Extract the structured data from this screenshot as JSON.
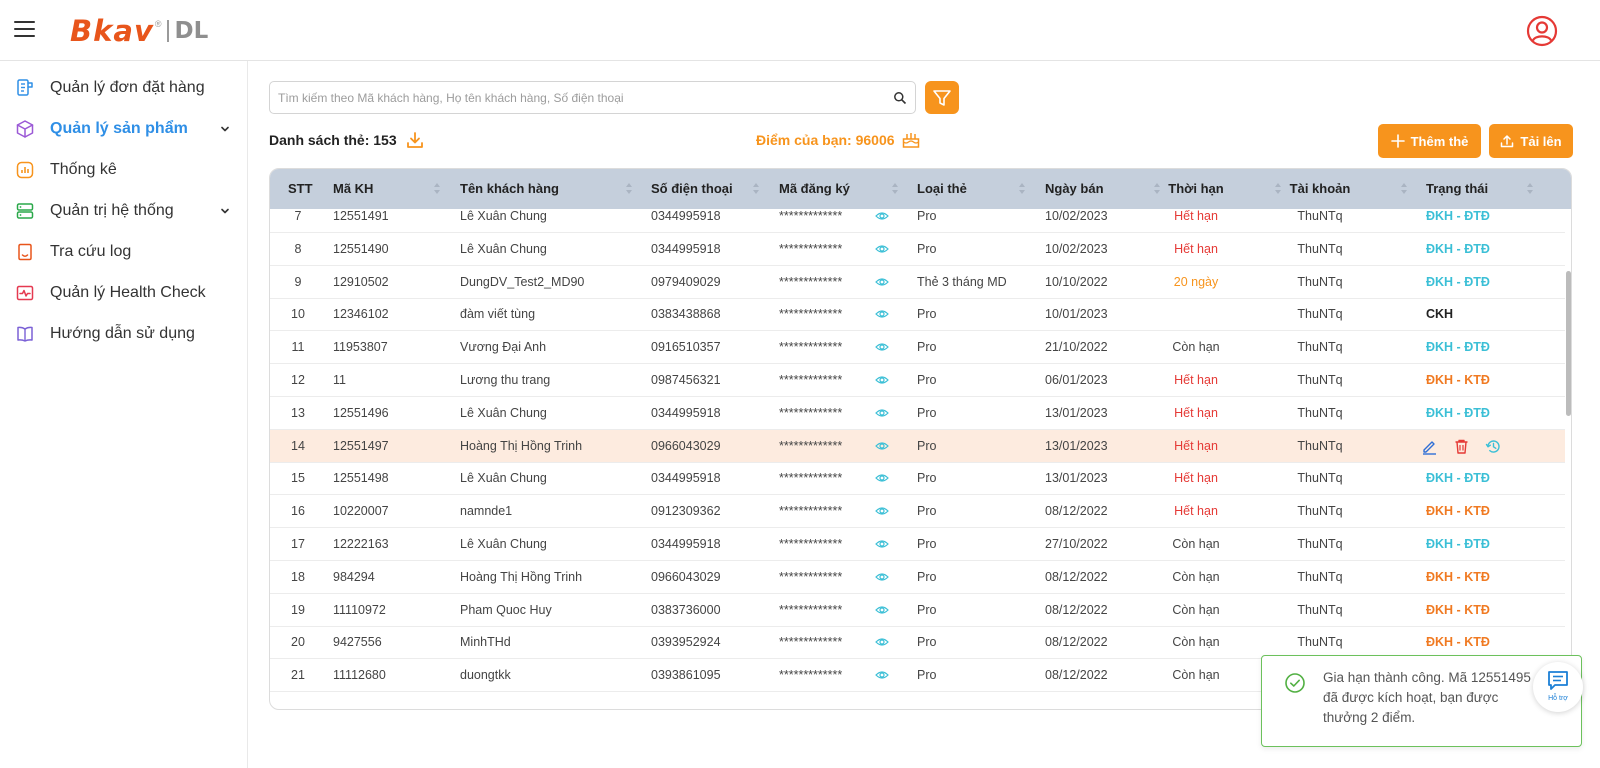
{
  "header": {
    "logo_main": "Bkav",
    "logo_dot": "®",
    "logo_sub": "DL"
  },
  "sidebar": {
    "items": [
      {
        "label": "Quản lý đơn đặt hàng",
        "icon": "order-icon",
        "active": false,
        "expandable": false
      },
      {
        "label": "Quản lý sản phẩm",
        "icon": "product-box-icon",
        "active": true,
        "expandable": true
      },
      {
        "label": "Thống kê",
        "icon": "stats-icon",
        "active": false,
        "expandable": false
      },
      {
        "label": "Quản trị hệ thống",
        "icon": "server-icon",
        "active": false,
        "expandable": true
      },
      {
        "label": "Tra cứu log",
        "icon": "log-icon",
        "active": false,
        "expandable": false
      },
      {
        "label": "Quản lý Health Check",
        "icon": "health-check-icon",
        "active": false,
        "expandable": false
      },
      {
        "label": "Hướng dẫn sử dụng",
        "icon": "guide-book-icon",
        "active": false,
        "expandable": false
      }
    ]
  },
  "search": {
    "placeholder": "Tìm kiếm theo Mã khách hàng, Họ tên khách hàng, Số điện thoại",
    "value": ""
  },
  "list": {
    "title": "Danh sách thẻ: 153",
    "points": "Điểm của bạn: 96006"
  },
  "actions": {
    "add_label": "Thêm thẻ",
    "upload_label": "Tải lên"
  },
  "table": {
    "columns": [
      "STT",
      "Mã KH",
      "Tên khách hàng",
      "Số điện thoại",
      "Mã đăng ký",
      "Loại thẻ",
      "Ngày bán",
      "Thời hạn",
      "Tài khoản",
      "Trạng thái"
    ],
    "rows": [
      {
        "stt": "7",
        "makh": "12551491",
        "name": "Lê Xuân Chung",
        "phone": "0344995918",
        "code": "*************",
        "type": "Pro",
        "date": "10/02/2023",
        "term": "Hết hạn",
        "account": "ThuNTq",
        "status": "ĐKH - ĐTĐ"
      },
      {
        "stt": "8",
        "makh": "12551490",
        "name": "Lê Xuân Chung",
        "phone": "0344995918",
        "code": "*************",
        "type": "Pro",
        "date": "10/02/2023",
        "term": "Hết hạn",
        "account": "ThuNTq",
        "status": "ĐKH - ĐTĐ"
      },
      {
        "stt": "9",
        "makh": "12910502",
        "name": "DungDV_Test2_MD90",
        "phone": "0979409029",
        "code": "*************",
        "type": "Thẻ 3 tháng MD",
        "date": "10/10/2022",
        "term": "20 ngày",
        "account": "ThuNTq",
        "status": "ĐKH - ĐTĐ"
      },
      {
        "stt": "10",
        "makh": "12346102",
        "name": "đàm viết tùng",
        "phone": "0383438868",
        "code": "*************",
        "type": "Pro",
        "date": "10/01/2023",
        "term": "",
        "account": "ThuNTq",
        "status": "CKH"
      },
      {
        "stt": "11",
        "makh": "11953807",
        "name": "Vương Đại Anh",
        "phone": "0916510357",
        "code": "*************",
        "type": "Pro",
        "date": "21/10/2022",
        "term": "Còn hạn",
        "account": "ThuNTq",
        "status": "ĐKH - ĐTĐ"
      },
      {
        "stt": "12",
        "makh": "11",
        "name": "Lương thu trang",
        "phone": "0987456321",
        "code": "*************",
        "type": "Pro",
        "date": "06/01/2023",
        "term": "Hết hạn",
        "account": "ThuNTq",
        "status": "ĐKH - KTĐ"
      },
      {
        "stt": "13",
        "makh": "12551496",
        "name": "Lê Xuân Chung",
        "phone": "0344995918",
        "code": "*************",
        "type": "Pro",
        "date": "13/01/2023",
        "term": "Hết hạn",
        "account": "ThuNTq",
        "status": "ĐKH - ĐTĐ"
      },
      {
        "stt": "14",
        "makh": "12551497",
        "name": "Hoàng Thị Hồng Trinh",
        "phone": "0966043029",
        "code": "*************",
        "type": "Pro",
        "date": "13/01/2023",
        "term": "Hết hạn",
        "account": "ThuNTq",
        "status": ""
      },
      {
        "stt": "15",
        "makh": "12551498",
        "name": "Lê Xuân Chung",
        "phone": "0344995918",
        "code": "*************",
        "type": "Pro",
        "date": "13/01/2023",
        "term": "Hết hạn",
        "account": "ThuNTq",
        "status": "ĐKH - ĐTĐ"
      },
      {
        "stt": "16",
        "makh": "10220007",
        "name": "namnde1",
        "phone": "0912309362",
        "code": "*************",
        "type": "Pro",
        "date": "08/12/2022",
        "term": "Hết hạn",
        "account": "ThuNTq",
        "status": "ĐKH - KTĐ"
      },
      {
        "stt": "17",
        "makh": "12222163",
        "name": "Lê Xuân Chung",
        "phone": "0344995918",
        "code": "*************",
        "type": "Pro",
        "date": "27/10/2022",
        "term": "Còn hạn",
        "account": "ThuNTq",
        "status": "ĐKH - ĐTĐ"
      },
      {
        "stt": "18",
        "makh": "984294",
        "name": "Hoàng Thị Hồng Trinh",
        "phone": "0966043029",
        "code": "*************",
        "type": "Pro",
        "date": "08/12/2022",
        "term": "Còn hạn",
        "account": "ThuNTq",
        "status": "ĐKH - KTĐ"
      },
      {
        "stt": "19",
        "makh": "11110972",
        "name": "Pham Quoc Huy",
        "phone": "0383736000",
        "code": "*************",
        "type": "Pro",
        "date": "08/12/2022",
        "term": "Còn hạn",
        "account": "ThuNTq",
        "status": "ĐKH - KTĐ"
      },
      {
        "stt": "20",
        "makh": "9427556",
        "name": "MinhTHd",
        "phone": "0393952924",
        "code": "*************",
        "type": "Pro",
        "date": "08/12/2022",
        "term": "Còn hạn",
        "account": "ThuNTq",
        "status": "ĐKH - KTĐ"
      },
      {
        "stt": "21",
        "makh": "11112680",
        "name": "duongtkk",
        "phone": "0393861095",
        "code": "*************",
        "type": "Pro",
        "date": "08/12/2022",
        "term": "Còn hạn",
        "account": "ThuNTq",
        "status": ""
      }
    ]
  },
  "toast": {
    "message": "Gia hạn thành công. Mã 12551495 đã được kích hoạt, bạn được thưởng 2 điểm."
  },
  "support": {
    "label": "Hỗ trợ"
  },
  "colors": {
    "accent": "#f7941d",
    "brand": "#e8551b",
    "active_nav": "#2f8fe6",
    "expired": "#e53935",
    "warning": "#f7941d",
    "status_teal": "#3bbfd6",
    "status_orange": "#f07a22",
    "header_bg": "#c5cfdc",
    "highlight_row": "#fdebdf",
    "success": "#6cc15c"
  }
}
